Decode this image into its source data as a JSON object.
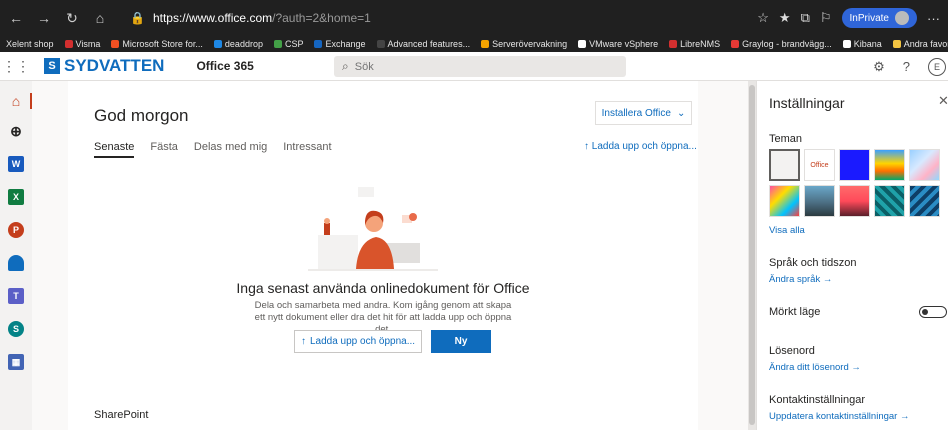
{
  "browser": {
    "url_host": "https://www.office.com",
    "url_rest": "/?auth=2&home=1",
    "inprivate_label": "InPrivate"
  },
  "favorites": [
    {
      "label": "Xelent shop",
      "color": ""
    },
    {
      "label": "Visma",
      "color": "#d32f2f"
    },
    {
      "label": "Microsoft Store for...",
      "color": "#f25022"
    },
    {
      "label": "deaddrop",
      "color": "#1e88e5"
    },
    {
      "label": "CSP",
      "color": "#43a047"
    },
    {
      "label": "Exchange",
      "color": "#1565c0"
    },
    {
      "label": "Advanced features...",
      "color": "#444444"
    },
    {
      "label": "Serverövervakning",
      "color": "#f4a300"
    },
    {
      "label": "VMware vSphere",
      "color": "#ffffff"
    },
    {
      "label": "LibreNMS",
      "color": "#d32f2f"
    },
    {
      "label": "Graylog - brandvägg...",
      "color": "#e53935"
    },
    {
      "label": "Kibana",
      "color": "#ffffff"
    },
    {
      "label": "Andra favoriter",
      "color": "#f4c542"
    }
  ],
  "header": {
    "brand": "SYDVATTEN",
    "suite": "Office 365",
    "search_placeholder": "Sök",
    "avatar_initial": "E"
  },
  "main": {
    "greeting": "God morgon",
    "install_label": "Installera Office",
    "tabs": [
      "Senaste",
      "Fästa",
      "Delas med mig",
      "Intressant"
    ],
    "upload_link": "Ladda upp och öppna...",
    "empty_title": "Inga senast använda onlinedokument för Office",
    "empty_desc": "Dela och samarbeta med andra. Kom igång genom att skapa ett nytt dokument eller dra det hit för att ladda upp och öppna det.",
    "upload_button": "Ladda upp och öppna...",
    "new_button": "Ny",
    "sharepoint": "SharePoint"
  },
  "settings": {
    "title": "Inställningar",
    "themes_heading": "Teman",
    "theme_office_label": "Office",
    "show_all": "Visa alla",
    "lang_heading": "Språk och tidszon",
    "lang_link": "Ändra språk →",
    "dark_mode": "Mörkt läge",
    "dark_mode_on": false,
    "password_heading": "Lösenord",
    "password_link": "Ändra ditt lösenord →",
    "contact_heading": "Kontaktinställningar",
    "contact_link": "Uppdatera kontaktinställningar →"
  },
  "colors": {
    "accent": "#0f6cbd",
    "rail_home": "#c43e1c"
  }
}
